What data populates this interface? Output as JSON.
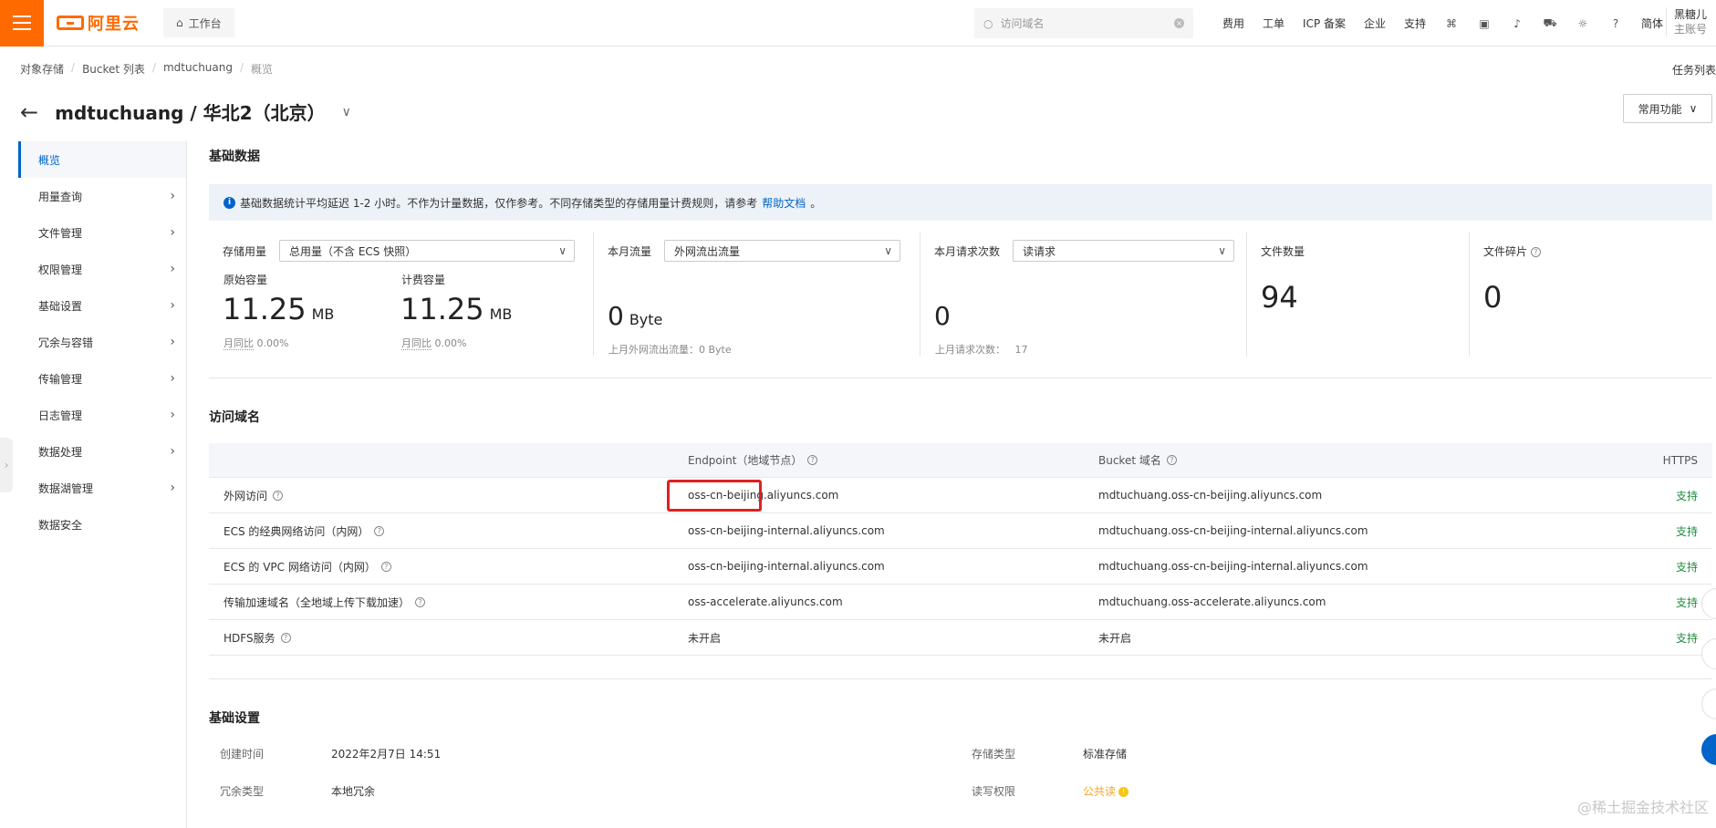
{
  "topbar": {
    "logo_text": "阿里云",
    "workbench": "工作台",
    "search_placeholder": "访问域名",
    "links": [
      "费用",
      "工单",
      "ICP 备案",
      "企业",
      "支持"
    ],
    "lang": "简体",
    "account_name": "黑糖儿",
    "account_type": "主账号"
  },
  "breadcrumb": [
    "对象存储",
    "Bucket 列表",
    "mdtuchuang",
    "概览"
  ],
  "task_list": "任务列表",
  "page_title": "mdtuchuang / 华北2（北京）",
  "common_functions": "常用功能",
  "sidebar": [
    {
      "label": "概览",
      "active": true,
      "arrow": false
    },
    {
      "label": "用量查询",
      "arrow": true
    },
    {
      "label": "文件管理",
      "arrow": true
    },
    {
      "label": "权限管理",
      "arrow": true
    },
    {
      "label": "基础设置",
      "arrow": true
    },
    {
      "label": "冗余与容错",
      "arrow": true
    },
    {
      "label": "传输管理",
      "arrow": true
    },
    {
      "label": "日志管理",
      "arrow": true
    },
    {
      "label": "数据处理",
      "arrow": true
    },
    {
      "label": "数据湖管理",
      "arrow": true
    },
    {
      "label": "数据安全",
      "arrow": false
    }
  ],
  "basic_data": {
    "title": "基础数据",
    "notice_text": "基础数据统计平均延迟 1-2 小时。不作为计量数据，仅作参考。不同存储类型的存储用量计费规则，请参考",
    "notice_link": "帮助文档",
    "notice_end": "。",
    "storage": {
      "label": "存储用量",
      "select": "总用量（不含 ECS 快照）",
      "raw_label": "原始容量",
      "raw_value": "11.25",
      "raw_unit": "MB",
      "raw_mom_label": "月同比",
      "raw_mom": "0.00%",
      "billing_label": "计费容量",
      "billing_value": "11.25",
      "billing_unit": "MB",
      "billing_mom_label": "月同比",
      "billing_mom": "0.00%"
    },
    "traffic": {
      "label": "本月流量",
      "select": "外网流出流量",
      "value": "0",
      "unit": "Byte",
      "last_month": "上月外网流出流量：0 Byte"
    },
    "requests": {
      "label": "本月请求次数",
      "select": "读请求",
      "value": "0",
      "last_month_label": "上月请求次数：",
      "last_month_value": "17"
    },
    "files": {
      "label": "文件数量",
      "value": "94"
    },
    "fragments": {
      "label": "文件碎片",
      "value": "0"
    }
  },
  "domains": {
    "title": "访问域名",
    "headers": {
      "endpoint": "Endpoint（地域节点）",
      "bucket": "Bucket 域名",
      "https": "HTTPS"
    },
    "rows": [
      {
        "name": "外网访问",
        "endpoint": "oss-cn-beijing.aliyuncs.com",
        "bucket": "mdtuchuang.oss-cn-beijing.aliyuncs.com",
        "https": "支持"
      },
      {
        "name": "ECS 的经典网络访问（内网）",
        "endpoint": "oss-cn-beijing-internal.aliyuncs.com",
        "bucket": "mdtuchuang.oss-cn-beijing-internal.aliyuncs.com",
        "https": "支持"
      },
      {
        "name": "ECS 的 VPC 网络访问（内网）",
        "endpoint": "oss-cn-beijing-internal.aliyuncs.com",
        "bucket": "mdtuchuang.oss-cn-beijing-internal.aliyuncs.com",
        "https": "支持"
      },
      {
        "name": "传输加速域名（全地域上传下载加速）",
        "endpoint": "oss-accelerate.aliyuncs.com",
        "bucket": "mdtuchuang.oss-accelerate.aliyuncs.com",
        "https": "支持"
      },
      {
        "name": "HDFS服务",
        "endpoint": "未开启",
        "bucket": "未开启",
        "https": "支持"
      }
    ]
  },
  "basic_settings": {
    "title": "基础设置",
    "created_label": "创建时间",
    "created_value": "2022年2月7日 14:51",
    "redundancy_label": "冗余类型",
    "redundancy_value": "本地冗余",
    "storage_type_label": "存储类型",
    "storage_type_value": "标准存储",
    "acl_label": "读写权限",
    "acl_value": "公共读"
  },
  "watermark": "@稀土掘金技术社区",
  "colors": {
    "brand": "#ff6a00",
    "link": "#0064c8",
    "success": "#1e8e3e",
    "highlight": "#e02020"
  }
}
